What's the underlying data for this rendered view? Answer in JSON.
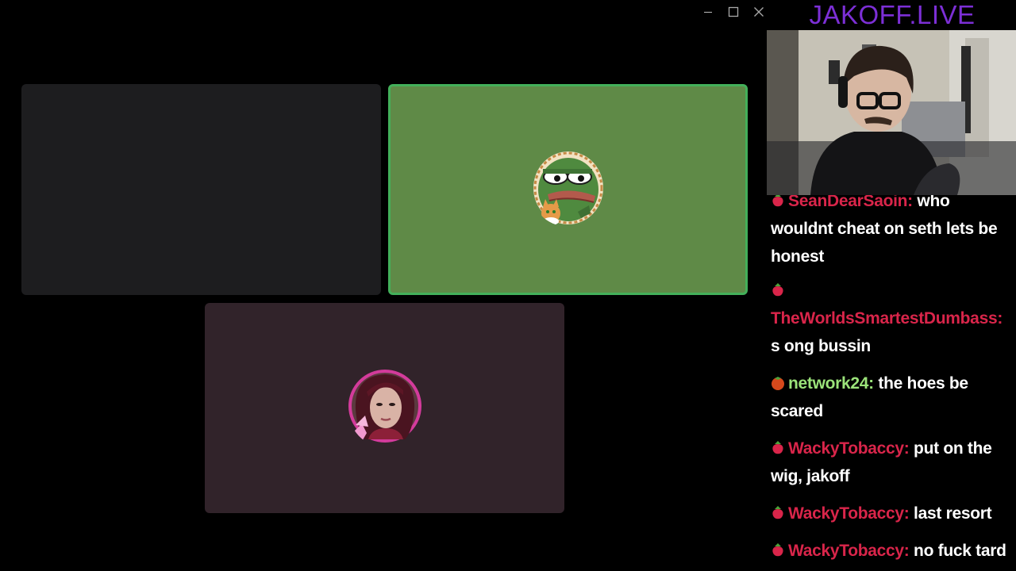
{
  "brand": {
    "title": "JAKOFF.LIVE",
    "color": "#7c2fd6"
  },
  "window_controls": {
    "minimize": "minimize-icon",
    "maximize": "maximize-icon",
    "close": "close-icon"
  },
  "call": {
    "tiles": [
      {
        "id": "empty",
        "color": "#1d1d1f"
      },
      {
        "id": "pepe",
        "color": "#5f8a47",
        "speaking": true,
        "border_color": "#43b05a"
      },
      {
        "id": "girl",
        "color": "#31232a"
      }
    ]
  },
  "chat": {
    "messages": [
      {
        "user": "SeanDearSaoin:",
        "user_color": "#d9254a",
        "text": "who wouldnt cheat on seth lets be honest",
        "badge": "strawberry-icon"
      },
      {
        "user": "TheWorldsSmartestDumbass:",
        "user_color": "#d9254a",
        "text": "s ong bussin",
        "badge": "strawberry-icon"
      },
      {
        "user": "network24:",
        "user_color": "#9be37a",
        "text": "the hoes be scared",
        "badge": "tomato-icon"
      },
      {
        "user": "WackyTobaccy:",
        "user_color": "#d9254a",
        "text": "put on the wig, jakoff",
        "badge": "strawberry-icon"
      },
      {
        "user": "WackyTobaccy:",
        "user_color": "#d9254a",
        "text": "last resort",
        "badge": "strawberry-icon"
      },
      {
        "user": "WackyTobaccy:",
        "user_color": "#d9254a",
        "text": "no fuck tard",
        "badge": "strawberry-icon"
      }
    ]
  }
}
